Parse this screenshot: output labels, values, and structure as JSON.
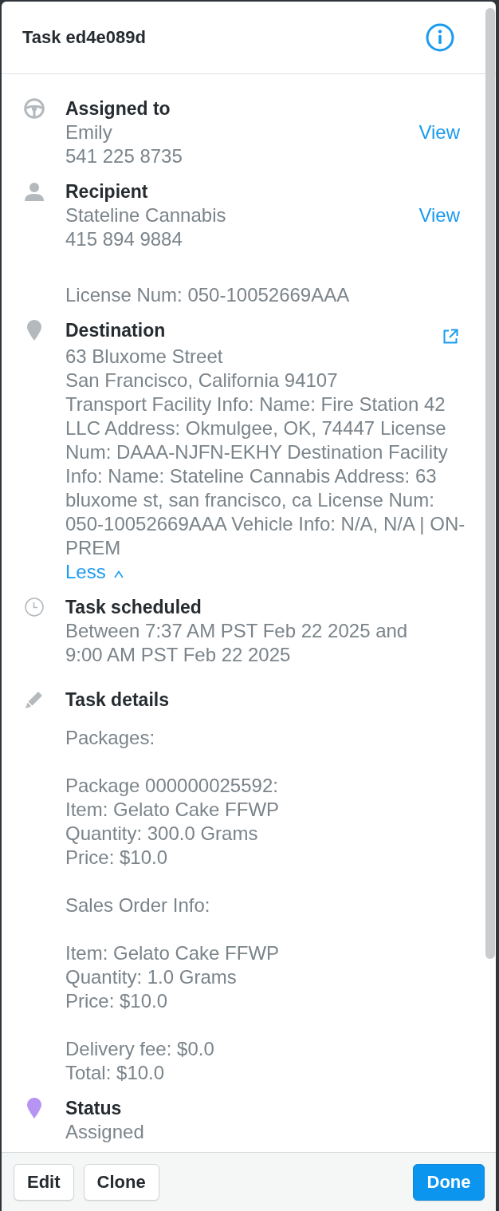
{
  "header": {
    "title": "Task ed4e089d"
  },
  "sections": [
    {
      "kind": "assignee",
      "title": "Assigned to",
      "lines": [
        "Emily",
        "541 225 8735"
      ],
      "action": {
        "kind": "link",
        "label": "View"
      }
    },
    {
      "kind": "recipient",
      "title": "Recipient",
      "lines": [
        "Stateline Cannabis",
        "415 894 9884"
      ],
      "action": {
        "kind": "link",
        "label": "View"
      },
      "note": "License Num: 050-10052669AAA"
    },
    {
      "kind": "destination",
      "title": "Destination",
      "action": {
        "kind": "external"
      },
      "lines": [
        "63 Bluxome Street",
        "San Francisco, California 94107"
      ],
      "info": "Transport Facility Info: Name: Fire Station 42 LLC Address: Okmulgee, OK, 74447 License Num: DAAA-NJFN-EKHY Destination Facility Info: Name: Stateline Cannabis Address: 63 bluxome st, san francisco, ca License Num: 050-10052669AAA Vehicle Info: N/A, N/A | ON-PREM",
      "toggle": {
        "label": "Less",
        "expanded": true
      }
    },
    {
      "kind": "schedule",
      "title": "Task scheduled",
      "text": "Between 7:37 AM PST Feb 22 2025 and\n9:00 AM PST Feb 22 2025"
    },
    {
      "kind": "details",
      "title": "Task details",
      "paragraphs": [
        [
          "Packages:"
        ],
        [
          "Package 000000025592:",
          "Item: Gelato Cake FFWP",
          "Quantity: 300.0 Grams",
          "Price: $10.0"
        ],
        [
          "Sales Order Info:"
        ],
        [
          "Item: Gelato Cake FFWP",
          "Quantity: 1.0 Grams",
          "Price: $10.0"
        ],
        [
          "Delivery fee: $0.0",
          "Total: $10.0"
        ]
      ]
    },
    {
      "kind": "status",
      "title": "Status",
      "lines": [
        "Assigned"
      ],
      "color": "#b794f4"
    }
  ],
  "footer": {
    "buttons": [
      {
        "label": "Edit",
        "kind": "secondary"
      },
      {
        "label": "Clone",
        "kind": "secondary"
      },
      {
        "label": "Done",
        "kind": "primary"
      }
    ]
  }
}
